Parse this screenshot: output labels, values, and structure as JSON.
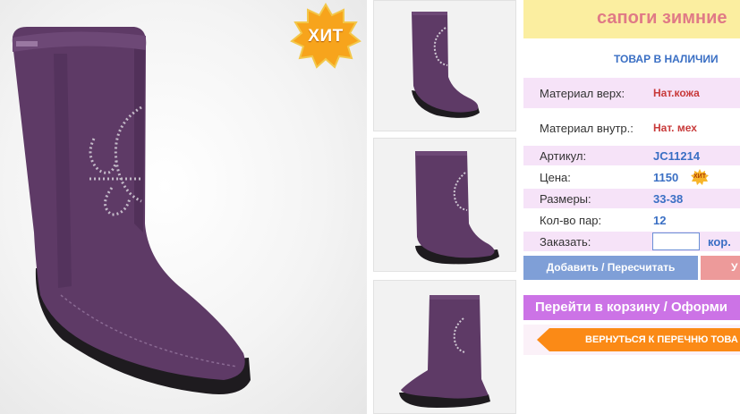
{
  "badge": {
    "hit_label": "ХИТ"
  },
  "product": {
    "title": "сапоги зимние",
    "stock_status": "ТОВАР В НАЛИЧИИ",
    "colors": {
      "boot": "#5e3a66",
      "sole": "#1e1b1f",
      "accent": "#fb8a16",
      "title": "#e07a86"
    }
  },
  "specs": {
    "material_top": {
      "label": "Материал верх:",
      "value": "Нат.кожа"
    },
    "material_inner": {
      "label": "Материал внутр.:",
      "value": "Нат. мех"
    },
    "article": {
      "label": "Артикул:",
      "value": "JC11214"
    },
    "price": {
      "label": "Цена:",
      "value": "1150",
      "badge": "ХИТ"
    },
    "sizes": {
      "label": "Размеры:",
      "value": "33-38"
    },
    "pairs": {
      "label": "Кол-во пар:",
      "value": "12"
    },
    "order": {
      "label": "Заказать:",
      "value": "",
      "unit": "кор."
    }
  },
  "actions": {
    "add_label": "Добавить / Пересчитать",
    "delete_label": "У",
    "cart_label": "Перейти в корзину / Оформи",
    "back_label": "ВЕРНУТЬСЯ К ПЕРЕЧНЮ ТОВА"
  },
  "thumbnails": [
    {
      "name": "thumbnail-1",
      "icon": "boot-front-view"
    },
    {
      "name": "thumbnail-2",
      "icon": "boot-side-view"
    },
    {
      "name": "thumbnail-3",
      "icon": "boot-back-view"
    }
  ]
}
